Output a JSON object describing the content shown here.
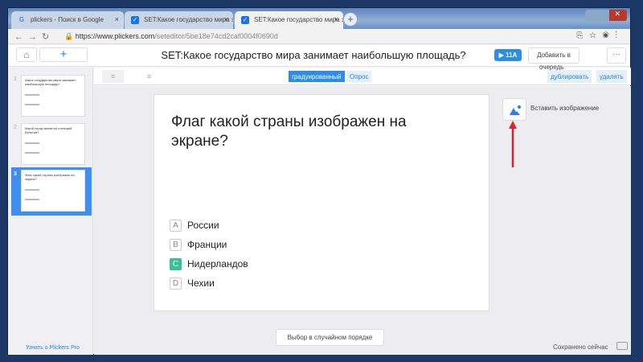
{
  "browser": {
    "tabs": [
      {
        "label": "plickers - Поиск в Google",
        "icon": "google-icon"
      },
      {
        "label": "SET:Какое государство мира за",
        "icon": "checkbox-icon"
      },
      {
        "label": "SET:Какое государство мира за",
        "icon": "checkbox-icon"
      }
    ],
    "url_host": "https://www.plickers.com",
    "url_path": "/seteditor/5be18e74cd2caf0004f0690d"
  },
  "header": {
    "title": "SET:Какое государство мира занимает наибольшую площадь?",
    "play_label": "▶ 11A",
    "queue_label": "Добавить в",
    "queue_label2": "очередь",
    "more": "···"
  },
  "toolbar": {
    "graded": "градуированный",
    "survey": "Опрос",
    "duplicate": "дублировать",
    "delete": "удалять"
  },
  "sidebar": {
    "slides": [
      {
        "num": "1",
        "text": "Какое государство мира занимает наибольшую площадь?"
      },
      {
        "num": "2",
        "text": "Какой город является столицей Бельгии?"
      },
      {
        "num": "3",
        "text": "Флаг какой страны изображен на экране?"
      }
    ],
    "pro_link": "Узнать о Plickers Pro"
  },
  "question": {
    "text": "Флаг какой страны изображен на экране?",
    "choices": [
      {
        "letter": "A",
        "text": "России",
        "correct": false
      },
      {
        "letter": "B",
        "text": "Франции",
        "correct": false
      },
      {
        "letter": "C",
        "text": "Нидерландов",
        "correct": true
      },
      {
        "letter": "D",
        "text": "Чехии",
        "correct": false
      }
    ]
  },
  "insert_image": "Вставить изображение",
  "shuffle": "Выбор в случайном порядке",
  "status": "Сохранено сейчас",
  "colors": {
    "accent": "#2b8de6",
    "correct": "#35c29a",
    "frame": "#1d3866"
  }
}
